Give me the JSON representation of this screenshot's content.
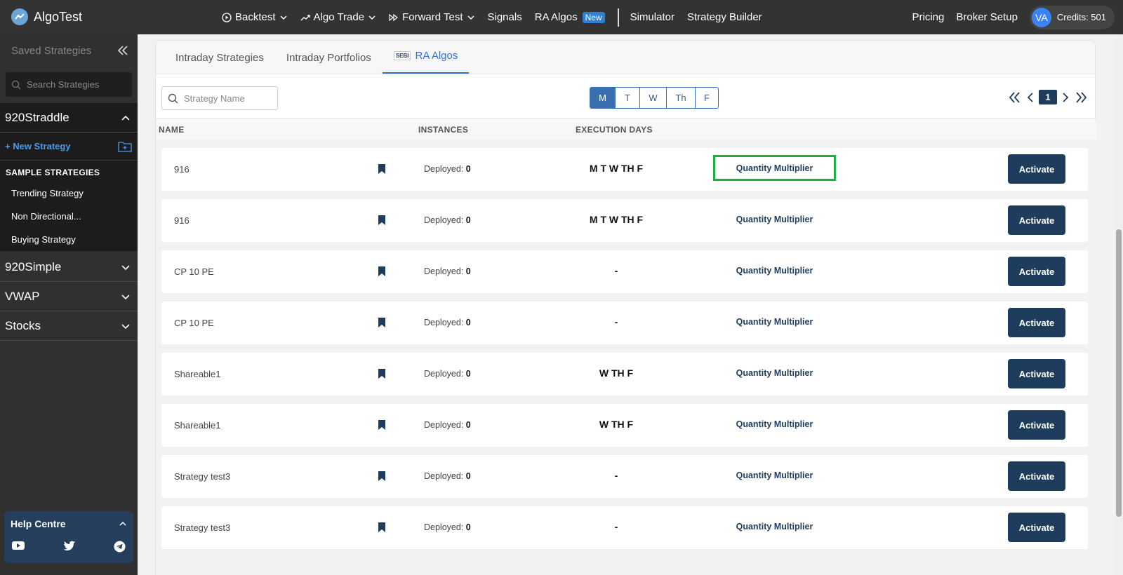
{
  "brand": {
    "name": "AlgoTest"
  },
  "nav": {
    "items": [
      {
        "label": "Backtest",
        "icon": "play-circle-icon",
        "dropdown": true
      },
      {
        "label": "Algo Trade",
        "icon": "trend-up-icon",
        "dropdown": true
      },
      {
        "label": "Forward Test",
        "icon": "fast-forward-icon",
        "dropdown": true
      },
      {
        "label": "Signals"
      },
      {
        "label": "RA Algos",
        "badge": "New"
      },
      {
        "label": "Simulator"
      },
      {
        "label": "Strategy Builder"
      }
    ],
    "right": {
      "pricing": "Pricing",
      "broker_setup": "Broker Setup",
      "avatar_initials": "VA",
      "credits": "Credits: 501"
    }
  },
  "sidebar": {
    "title": "Saved Strategies",
    "search_placeholder": "Search Strategies",
    "open_group": {
      "name": "920Straddle",
      "new_strategy": "+ New Strategy",
      "sample_heading": "SAMPLE STRATEGIES",
      "samples": [
        "Trending Strategy",
        "Non Directional...",
        "Buying Strategy"
      ]
    },
    "groups": [
      "920Simple",
      "VWAP",
      "Stocks"
    ],
    "help": {
      "title": "Help Centre"
    }
  },
  "tabs": [
    "Intraday Strategies",
    "Intraday Portfolios",
    "RA Algos"
  ],
  "tab_sebi_label": "SEBI",
  "toolbar": {
    "search_placeholder": "Strategy Name",
    "days": [
      "M",
      "T",
      "W",
      "Th",
      "F"
    ],
    "active_day": "M",
    "page": "1"
  },
  "table": {
    "headers": {
      "name": "NAME",
      "instances": "INSTANCES",
      "execution_days": "EXECUTION DAYS"
    },
    "deployed_label": "Deployed:",
    "qm_label": "Quantity Multiplier",
    "activate_label": "Activate",
    "rows": [
      {
        "name": "916",
        "deployed": "0",
        "days": "M T W TH F"
      },
      {
        "name": "916",
        "deployed": "0",
        "days": "M T W TH F"
      },
      {
        "name": "CP 10 PE",
        "deployed": "0",
        "days": "-"
      },
      {
        "name": "CP 10 PE",
        "deployed": "0",
        "days": "-"
      },
      {
        "name": "Shareable1",
        "deployed": "0",
        "days": "W TH F"
      },
      {
        "name": "Shareable1",
        "deployed": "0",
        "days": "W TH F"
      },
      {
        "name": "Strategy test3",
        "deployed": "0",
        "days": "-"
      },
      {
        "name": "Strategy test3",
        "deployed": "0",
        "days": "-"
      }
    ]
  },
  "colors": {
    "navbar": "#333333",
    "accent": "#2f6fd1",
    "button": "#1e3d5c",
    "highlight": "#22aa44"
  }
}
